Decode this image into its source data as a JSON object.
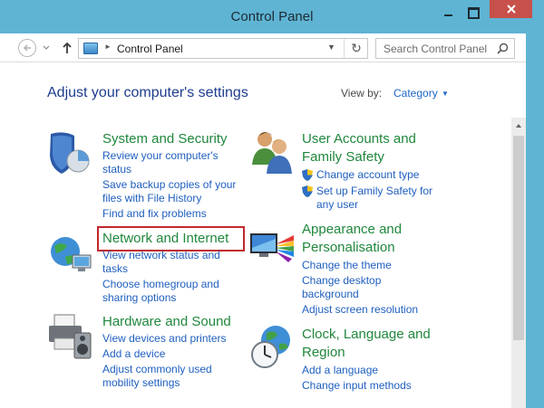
{
  "window": {
    "title": "Control Panel"
  },
  "navigation": {
    "back_icon": "back-arrow-icon",
    "history_icon": "chevron-down-icon",
    "up_icon": "up-arrow-icon",
    "address": {
      "location_icon": "control-panel-icon",
      "separator": "►",
      "path": "Control Panel",
      "dropdown": "▼",
      "refresh": "↻"
    },
    "search": {
      "placeholder": "Search Control Panel",
      "icon": "search-icon"
    }
  },
  "main": {
    "title": "Adjust your computer's settings",
    "view_by": {
      "label": "View by:",
      "value": "Category",
      "arrow": "▼"
    },
    "categories": [
      {
        "title": "System and Security",
        "icon": "shield-pie-chart-icon",
        "links": [
          "Review your computer's",
          "status",
          "Save backup copies of your",
          "files with File History",
          "Find and fix problems"
        ]
      },
      {
        "title": "Network and Internet",
        "icon": "globe-network-icon",
        "highlighted": true,
        "links": [
          "View network status and",
          "tasks",
          "Choose homegroup and",
          "sharing options"
        ]
      },
      {
        "title": "Hardware and Sound",
        "icon": "printer-speaker-icon",
        "links": [
          "View devices and printers",
          "Add a device",
          "Adjust commonly used",
          "mobility settings"
        ]
      },
      {
        "title_line1": "User Accounts and",
        "title_line2": "Family Safety",
        "icon": "users-icon",
        "links": [
          "Change account type",
          "Set up Family Safety for",
          "any user"
        ]
      },
      {
        "title_line1": "Appearance and",
        "title_line2": "Personalisation",
        "icon": "monitor-palette-icon",
        "links": [
          "Change the theme",
          "Change desktop",
          "background",
          "Adjust screen resolution"
        ]
      },
      {
        "title_line1": "Clock, Language and",
        "title_line2": "Region",
        "icon": "clock-globe-icon",
        "links": [
          "Add a language",
          "Change input methods"
        ]
      }
    ]
  },
  "colors": {
    "title_bar": "#5fb4d4",
    "category_title": "#20873c",
    "link": "#1f5fbf",
    "heading": "#1e3d8f",
    "highlight_box": "#c1272d",
    "close_button": "#c7504a"
  }
}
